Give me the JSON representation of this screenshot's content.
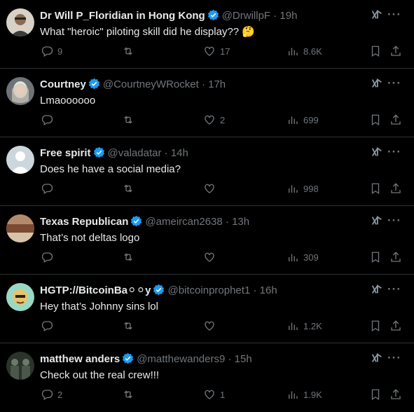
{
  "tweets": [
    {
      "name": "Dr Will P_Floridian in Hong Kong",
      "handle": "@DrwillpF",
      "dot": "·",
      "time": "19h",
      "text": "What \"heroic\" piloting skill did he display?? 🤔",
      "replies": "9",
      "retweets": "",
      "likes": "17",
      "views": "8.6K",
      "avatar_color": "#c9c3b8"
    },
    {
      "name": "Courtney",
      "handle": "@CourtneyWRocket",
      "dot": "·",
      "time": "17h",
      "text": "Lmaoooooo",
      "replies": "",
      "retweets": "",
      "likes": "2",
      "views": "699",
      "avatar_color": "#8a8f96"
    },
    {
      "name": "Free spirit",
      "handle": "@valadatar",
      "dot": "·",
      "time": "14h",
      "text": "Does he have a social media?",
      "replies": "",
      "retweets": "",
      "likes": "",
      "views": "998",
      "avatar_color": "#ccd6dd"
    },
    {
      "name": "Texas Republican",
      "handle": "@ameircan2638",
      "dot": "·",
      "time": "13h",
      "text": "That’s not deltas logo",
      "replies": "",
      "retweets": "",
      "likes": "",
      "views": "309",
      "avatar_color": "#a06a4e"
    },
    {
      "name": "HGTP://BitcoinBa⚪⚪y",
      "handle": "@bitcoinprophet1",
      "dot": "·",
      "time": "16h",
      "text": "Hey that’s Johnny sins lol",
      "replies": "",
      "retweets": "",
      "likes": "",
      "views": "1.2K",
      "avatar_color": "#8fd3c0"
    },
    {
      "name": "matthew anders",
      "handle": "@matthewanders9",
      "dot": "·",
      "time": "15h",
      "text": "Check out the real crew!!!",
      "replies": "2",
      "retweets": "",
      "likes": "1",
      "views": "1.9K",
      "avatar_color": "#3a4a3a"
    }
  ],
  "icons": {
    "reply": "reply-icon",
    "retweet": "retweet-icon",
    "like": "like-icon",
    "views": "views-icon",
    "bookmark": "bookmark-icon",
    "share": "share-icon",
    "grok": "grok-icon",
    "more": "more-icon",
    "verified": "verified-badge-icon"
  },
  "colors": {
    "background": "#000000",
    "text": "#e7e9ea",
    "muted": "#71767b",
    "verified": "#1d9bf0",
    "divider": "#2f3336"
  },
  "more_label": "···"
}
